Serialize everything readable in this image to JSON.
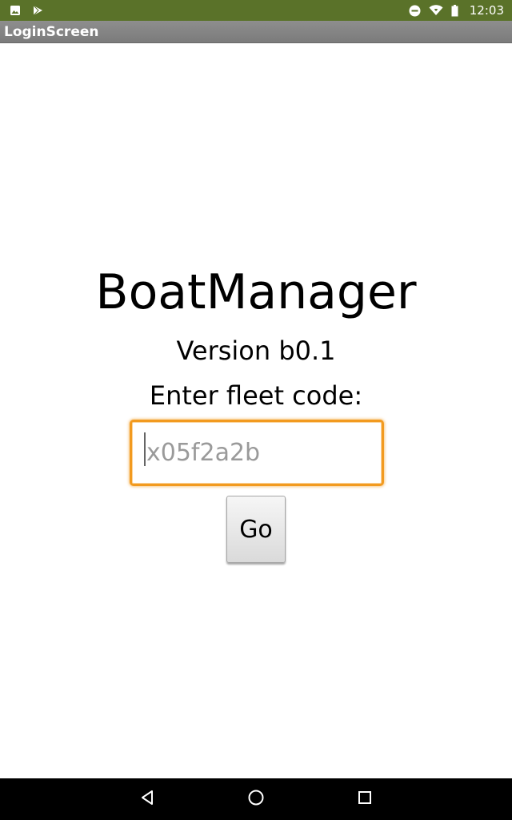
{
  "status_bar": {
    "time": "12:03",
    "left_icons": [
      "image-icon",
      "play-store-icon"
    ],
    "right_icons": [
      "do-not-disturb-icon",
      "wifi-icon",
      "battery-icon"
    ],
    "background_color": "#5a7229"
  },
  "title_bar": {
    "title": "LoginScreen"
  },
  "main": {
    "app_name": "BoatManager",
    "version": "Version b0.1",
    "prompt": "Enter fleet code:",
    "code_input": {
      "value": "",
      "placeholder": "x05f2a2b"
    },
    "go_button_label": "Go",
    "accent_color": "#f29a1f"
  },
  "nav_bar": {
    "buttons": [
      "back-icon",
      "home-icon",
      "recents-icon"
    ]
  }
}
